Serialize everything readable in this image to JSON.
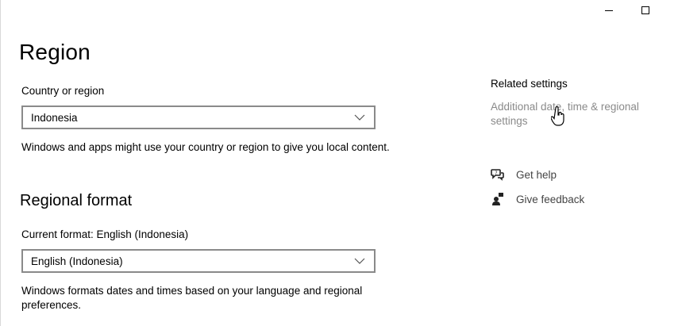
{
  "page": {
    "title": "Region"
  },
  "country": {
    "label": "Country or region",
    "value": "Indonesia",
    "description": "Windows and apps might use your country or region to give you local content."
  },
  "regional_format": {
    "heading": "Regional format",
    "current_label": "Current format: English (Indonesia)",
    "value": "English (Indonesia)",
    "description": "Windows formats dates and times based on your language and regional preferences."
  },
  "related": {
    "heading": "Related settings",
    "link": "Additional date, time & regional settings"
  },
  "help": {
    "get_help": "Get help",
    "give_feedback": "Give feedback"
  },
  "icons": {
    "minimize": "minimize-icon",
    "maximize": "maximize-icon",
    "chevron": "chevron-down-icon",
    "help": "help-chat-icon",
    "feedback": "feedback-icon",
    "cursor": "hand-cursor-icon"
  },
  "colors": {
    "link_disabled": "#8a8a8a",
    "border": "#8a8a8a"
  }
}
